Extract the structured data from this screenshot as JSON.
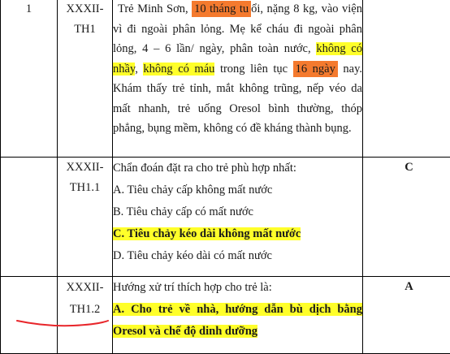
{
  "rows": [
    {
      "number": "1",
      "code_line1": "XXXII-",
      "code_line2": "TH1",
      "case_text": {
        "p1": "Trẻ Minh Sơn, ",
        "age": "10 tháng tu",
        "p2": "ổi, nặng 8 kg, vào viện vì đi ngoài phân lỏng. Mẹ kể cháu đi ngoài phân lỏng, 4 – 6 lần/ ngày, phân toàn nước, ",
        "hl1": "không có nhầy",
        "p3": ", ",
        "hl2": "không có máu",
        "p4": " trong liên tục ",
        "duration": "16 ngày",
        "p5": " nay. Khám thấy trẻ tỉnh, mắt không trũng, nếp véo da mất nhanh, trẻ uống Oresol bình thường, thóp phẳng, bụng mềm, không có đề kháng thành bụng."
      },
      "answer": ""
    },
    {
      "number": "",
      "code_line1": "XXXII-",
      "code_line2": "TH1.1",
      "question": "Chẩn đoán đặt ra cho trẻ phù hợp nhất:",
      "options": [
        "A. Tiêu chảy cấp không mất nước",
        "B. Tiêu chảy cấp có mất nước",
        "C. Tiêu chảy kéo dài không mất nước",
        "D. Tiêu chảy kéo dài có mất nước"
      ],
      "answer": "C"
    },
    {
      "number": "",
      "code_line1": "XXXII-",
      "code_line2": "TH1.2",
      "question": "Hướng xử trí thích hợp cho trẻ là:",
      "correct_option": "A. Cho trẻ về nhà, hướng dẫn bù dịch bằng Oresol và chế độ dinh dưỡng",
      "answer": "A"
    }
  ],
  "colors": {
    "orange_highlight": "#f47a2e",
    "yellow_highlight": "#ffff2a",
    "annotation_red": "#e8262b"
  }
}
